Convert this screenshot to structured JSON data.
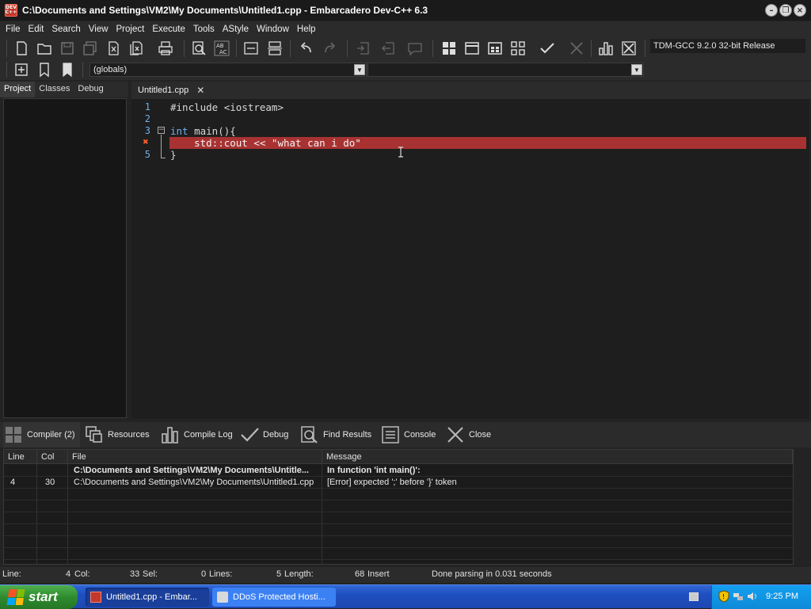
{
  "window": {
    "title": "C:\\Documents and Settings\\VM2\\My Documents\\Untitled1.cpp - Embarcadero Dev-C++ 6.3",
    "app_icon_text": "DEV C++"
  },
  "menu": [
    "File",
    "Edit",
    "Search",
    "View",
    "Project",
    "Execute",
    "Tools",
    "AStyle",
    "Window",
    "Help"
  ],
  "toolbar": {
    "compiler_select": "TDM-GCC 9.2.0 32-bit Release",
    "scope_select": "(globals)",
    "member_select": ""
  },
  "left_panel": {
    "tabs": [
      "Project",
      "Classes",
      "Debug"
    ]
  },
  "editor": {
    "tab_label": "Untitled1.cpp",
    "line_numbers": [
      "1",
      "2",
      "3",
      "4",
      "5"
    ],
    "lines": {
      "l1": "#include <iostream>",
      "l3_kw": "int",
      "l3_rest": " main(){",
      "l4": "    std::cout << \"what can i do\"",
      "l5": "}"
    }
  },
  "bottom_panel": {
    "tabs": {
      "compiler": "Compiler (2)",
      "resources": "Resources",
      "compile_log": "Compile Log",
      "debug": "Debug",
      "find_results": "Find Results",
      "console": "Console",
      "close": "Close"
    },
    "columns": [
      "Line",
      "Col",
      "File",
      "Message"
    ],
    "rows": [
      {
        "line": "",
        "col": "",
        "file": "C:\\Documents and Settings\\VM2\\My Documents\\Untitle...",
        "message": "In function 'int main()':"
      },
      {
        "line": "4",
        "col": "30",
        "file": "C:\\Documents and Settings\\VM2\\My Documents\\Untitled1.cpp",
        "message": "[Error] expected ';' before '}' token"
      }
    ]
  },
  "status": {
    "line_label": "Line:",
    "line_value": "4",
    "col_label": "Col:",
    "col_value": "33",
    "sel_label": "Sel:",
    "sel_value": "0",
    "lines_label": "Lines:",
    "lines_value": "5",
    "length_label": "Length:",
    "length_value": "68",
    "mode": "Insert",
    "message": "Done parsing in 0.031 seconds"
  },
  "taskbar": {
    "start_label": "start",
    "tasks": [
      "Untitled1.cpp - Embar...",
      "DDoS Protected Hosti..."
    ],
    "clock": "9:25 PM"
  },
  "colors": {
    "error_line": "#a83232",
    "line_number": "#6fb0e8",
    "keyword": "#6fb0e8"
  }
}
